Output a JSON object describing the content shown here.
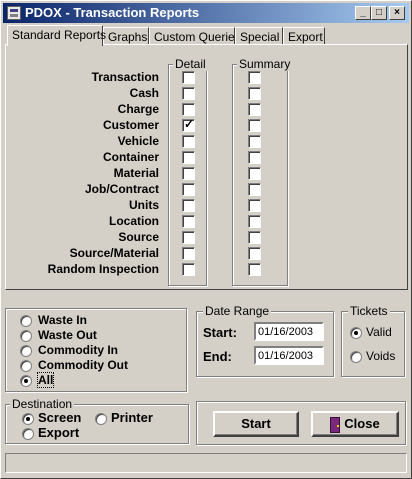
{
  "window": {
    "title": "PDOX - Transaction Reports",
    "min_glyph": "_",
    "max_glyph": "□",
    "close_glyph": "×"
  },
  "tabs": [
    {
      "label": "Standard Reports",
      "active": true
    },
    {
      "label": "Graphs",
      "active": false
    },
    {
      "label": "Custom Queries",
      "active": false
    },
    {
      "label": "Special",
      "active": false
    },
    {
      "label": "Export",
      "active": false
    }
  ],
  "report_groups": {
    "detail_title": "Detail",
    "summary_title": "Summary"
  },
  "report_rows": [
    {
      "label": "Transaction",
      "detail": false,
      "summary": false
    },
    {
      "label": "Cash",
      "detail": false,
      "summary": false
    },
    {
      "label": "Charge",
      "detail": false,
      "summary": false
    },
    {
      "label": "Customer",
      "detail": true,
      "summary": false
    },
    {
      "label": "Vehicle",
      "detail": false,
      "summary": false
    },
    {
      "label": "Container",
      "detail": false,
      "summary": false
    },
    {
      "label": "Material",
      "detail": false,
      "summary": false
    },
    {
      "label": "Job/Contract",
      "detail": false,
      "summary": false
    },
    {
      "label": "Units",
      "detail": false,
      "summary": false
    },
    {
      "label": "Location",
      "detail": false,
      "summary": false
    },
    {
      "label": "Source",
      "detail": false,
      "summary": false
    },
    {
      "label": "Source/Material",
      "detail": false,
      "summary": false
    },
    {
      "label": "Random Inspection",
      "detail": false,
      "summary": false
    }
  ],
  "check_glyph": "✓",
  "waste_options": [
    {
      "label": "Waste In",
      "selected": false
    },
    {
      "label": "Waste Out",
      "selected": false
    },
    {
      "label": "Commodity In",
      "selected": false
    },
    {
      "label": "Commodity Out",
      "selected": false
    },
    {
      "label": "All",
      "selected": true
    }
  ],
  "date_range": {
    "title": "Date Range",
    "start_label": "Start:",
    "start_value": "01/16/2003",
    "end_label": "End:",
    "end_value": "01/16/2003"
  },
  "tickets": {
    "title": "Tickets",
    "options": [
      {
        "label": "Valid",
        "selected": true
      },
      {
        "label": "Voids",
        "selected": false
      }
    ]
  },
  "destination": {
    "title": "Destination",
    "options": [
      {
        "label": "Screen",
        "selected": true
      },
      {
        "label": "Printer",
        "selected": false
      },
      {
        "label": "Export",
        "selected": false
      }
    ]
  },
  "buttons": {
    "start": "Start",
    "close": "Close"
  },
  "status_text": ""
}
